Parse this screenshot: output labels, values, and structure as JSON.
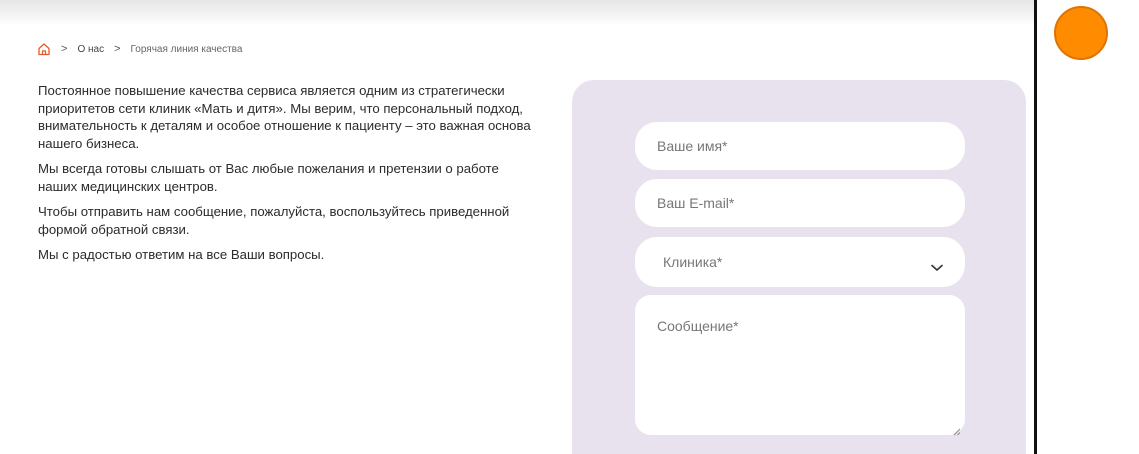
{
  "breadcrumb": {
    "home_icon": "home-icon",
    "items": [
      "О нас",
      "Горячая линия качества"
    ],
    "separator": ">"
  },
  "content": {
    "paragraphs": [
      "Постоянное повышение качества сервиса является одним из стратегически приоритетов сети клиник «Мать и дитя». Мы верим, что персональный подход, внимательность к деталям и особое отношение к пациенту – это важная основа нашего бизнеса.",
      "Мы всегда готовы слышать от Вас любые пожелания и претензии о работе наших медицинских центров.",
      "Чтобы отправить нам сообщение, пожалуйста, воспользуйтесь приведенной формой обратной связи.",
      "Мы с радостью ответим на все Ваши вопросы."
    ]
  },
  "form": {
    "name_placeholder": "Ваше имя*",
    "email_placeholder": "Ваш E-mail*",
    "clinic_selected": "Клиника*",
    "message_placeholder": "Сообщение*"
  },
  "colors": {
    "accent": "#ff8c00",
    "panel_bg": "#e8e2ee",
    "home_icon": "#e85a2b"
  }
}
